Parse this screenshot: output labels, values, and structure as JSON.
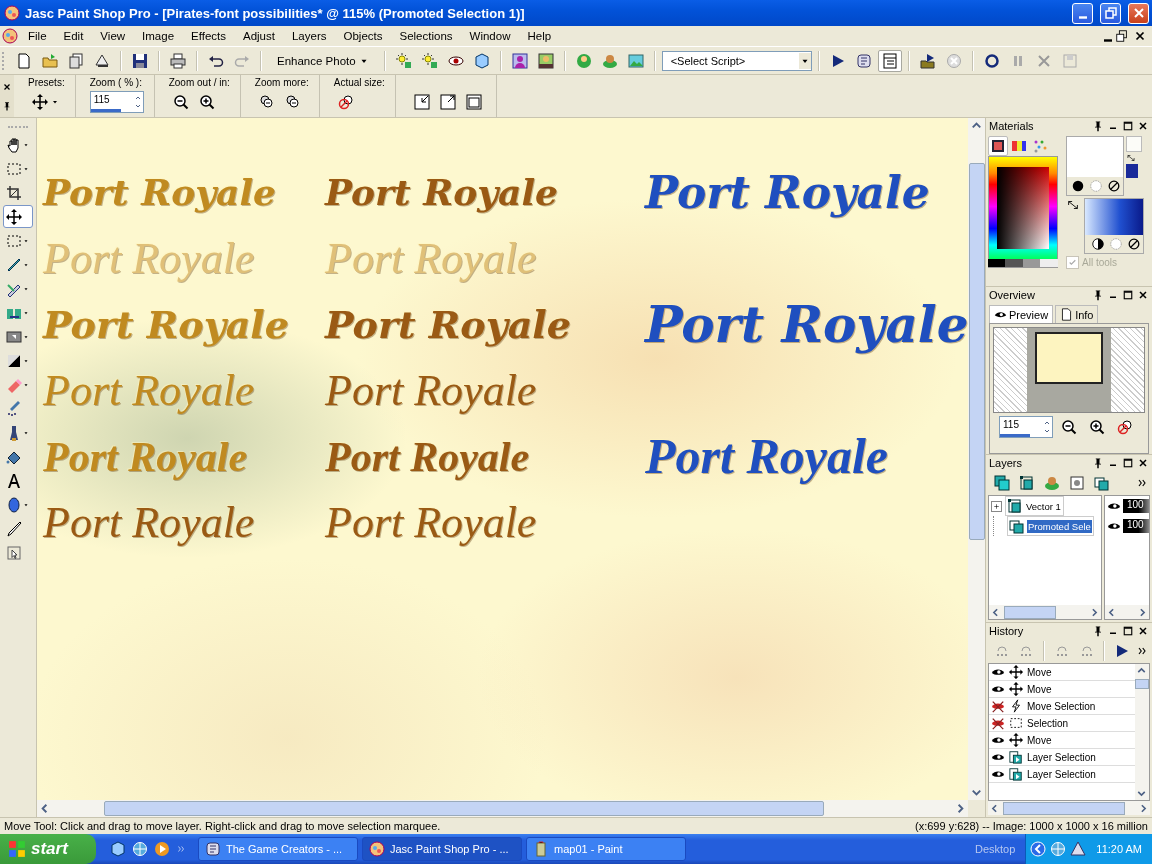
{
  "window": {
    "title": "Jasc Paint Shop Pro - [Pirates-font possibilities* @ 115% (Promoted Selection 1)]"
  },
  "menu": [
    "File",
    "Edit",
    "View",
    "Image",
    "Effects",
    "Adjust",
    "Layers",
    "Objects",
    "Selections",
    "Window",
    "Help"
  ],
  "toolbar": {
    "enhance": "Enhance Photo",
    "script": "<Select Script>"
  },
  "tool_options": {
    "presets_label": "Presets:",
    "zoom_label": "Zoom ( % ):",
    "zoom_value": "115",
    "zoom_out_in_label": "Zoom out / in:",
    "zoom_more_label": "Zoom more:",
    "actual_size_label": "Actual size:"
  },
  "tools": [
    {
      "selected": false
    },
    {
      "selected": false
    },
    {
      "selected": false
    },
    {
      "selected": true
    },
    {
      "selected": false
    },
    {
      "selected": false
    },
    {
      "selected": false
    },
    {
      "selected": false
    },
    {
      "selected": false
    },
    {
      "selected": false
    },
    {
      "selected": false
    },
    {
      "selected": false
    },
    {
      "selected": false
    },
    {
      "selected": false
    },
    {
      "selected": false
    },
    {
      "selected": false
    },
    {
      "selected": false
    },
    {
      "selected": false
    }
  ],
  "canvas": {
    "rows": [
      {
        "cells": [
          {
            "text": "Port Royale",
            "kind": "blackletter",
            "color": "#c08a20"
          },
          {
            "text": "Port Royale",
            "kind": "blackletter",
            "color": "#9a5a14"
          },
          {
            "text": "Port Royale",
            "kind": "blackletter",
            "color": "#1f4fbf"
          }
        ]
      },
      {
        "cells": [
          {
            "text": "Port Royale",
            "kind": "script",
            "color": "#e0c078"
          },
          {
            "text": "Port Royale",
            "kind": "script",
            "color": "#e0c078"
          },
          {
            "kind": "blank"
          }
        ]
      },
      {
        "cells": [
          {
            "text": "Port Royale",
            "kind": "brush",
            "color": "#c08a20"
          },
          {
            "text": "Port Royale",
            "kind": "brush",
            "color": "#9a5a14"
          },
          {
            "text": "Port Royale",
            "kind": "brush",
            "color": "#1f4fbf"
          }
        ]
      },
      {
        "cells": [
          {
            "text": "Port Royale",
            "kind": "script",
            "color": "#c08a20"
          },
          {
            "text": "Port Royale",
            "kind": "script",
            "color": "#9a5a14"
          },
          {
            "kind": "blank"
          }
        ]
      },
      {
        "cells": [
          {
            "text": "Port Royale",
            "kind": "bold",
            "color": "#c08a20"
          },
          {
            "text": "Port Royale",
            "kind": "bold",
            "color": "#9a5a14"
          },
          {
            "text": "Port Royale",
            "kind": "bold",
            "color": "#1f4fbf"
          }
        ]
      },
      {
        "cells": [
          {
            "text": "Port Royale",
            "kind": "script",
            "color": "#9a5a14"
          },
          {
            "text": "Port Royale",
            "kind": "script",
            "color": "#9a5a14"
          },
          {
            "kind": "blank"
          }
        ]
      }
    ]
  },
  "materials": {
    "title": "Materials",
    "all_tools": {
      "label": "All tools",
      "checked": true,
      "disabled": true
    }
  },
  "overview": {
    "title": "Overview",
    "tabs": [
      {
        "label": "Preview",
        "selected": true
      },
      {
        "label": "Info",
        "selected": false
      }
    ],
    "zoom_value": "115"
  },
  "layers": {
    "title": "Layers",
    "items": [
      {
        "name": "Vector 1",
        "selected": false,
        "expanded": false,
        "opacity": "100",
        "level": 1
      },
      {
        "name": "Promoted Sele",
        "selected": true,
        "opacity": "100",
        "level": 1
      }
    ]
  },
  "history": {
    "title": "History",
    "items": [
      {
        "label": "Move",
        "kind": "move",
        "visible": true
      },
      {
        "label": "Move",
        "kind": "move",
        "visible": true
      },
      {
        "label": "Move Selection",
        "kind": "lightning",
        "visible": false
      },
      {
        "label": "Selection",
        "kind": "selection",
        "visible": false
      },
      {
        "label": "Move",
        "kind": "move",
        "visible": true
      },
      {
        "label": "Layer Selection",
        "kind": "layer",
        "visible": true
      },
      {
        "label": "Layer Selection",
        "kind": "layer",
        "visible": true
      }
    ]
  },
  "status_bar": {
    "hint": "Move Tool: Click and drag to move layer. Right-click and drag to move selection marquee.",
    "info": "(x:699 y:628) -- Image:  1000 x 1000 x 16 million"
  },
  "taskbar": {
    "start": "start",
    "tasks": [
      {
        "label": "The Game Creators - ...",
        "selected": false
      },
      {
        "label": "Jasc Paint Shop Pro - ...",
        "selected": true
      },
      {
        "label": "map01 - Paint",
        "selected": false
      }
    ],
    "desktop": "Desktop",
    "clock": "11:20 AM"
  }
}
